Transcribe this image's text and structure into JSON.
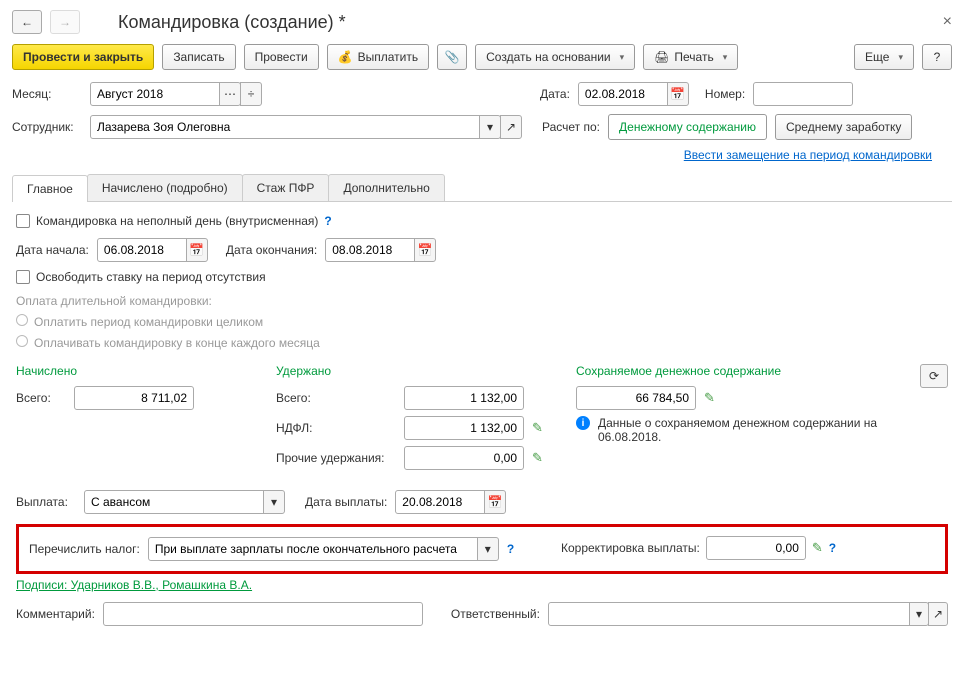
{
  "title": "Командировка (создание) *",
  "toolbar": {
    "post_close": "Провести и закрыть",
    "write": "Записать",
    "post": "Провести",
    "pay": "Выплатить",
    "create_based": "Создать на основании",
    "print": "Печать",
    "more": "Еще"
  },
  "fields": {
    "month_label": "Месяц:",
    "month_value": "Август 2018",
    "date_label": "Дата:",
    "date_value": "02.08.2018",
    "number_label": "Номер:",
    "number_value": "",
    "employee_label": "Сотрудник:",
    "employee_value": "Лазарева Зоя Олеговна",
    "calc_by_label": "Расчет по:",
    "calc_by_value": "Денежному содержанию",
    "avg_earn": "Среднему заработку",
    "substitution_link": "Ввести замещение на период командировки"
  },
  "tabs": {
    "main": "Главное",
    "accrued": "Начислено (подробно)",
    "pfr": "Стаж ПФР",
    "extra": "Дополнительно"
  },
  "main": {
    "partial_day": "Командировка на неполный день (внутрисменная)",
    "start_label": "Дата начала:",
    "start_value": "06.08.2018",
    "end_label": "Дата окончания:",
    "end_value": "08.08.2018",
    "release_rate": "Освободить ставку на период отсутствия",
    "long_trip_label": "Оплата длительной командировки:",
    "pay_whole": "Оплатить период командировки целиком",
    "pay_monthly": "Оплачивать командировку в конце каждого месяца"
  },
  "accrual": {
    "accrued_head": "Начислено",
    "withheld_head": "Удержано",
    "saved_head": "Сохраняемое денежное содержание",
    "total_label": "Всего:",
    "accrued_total": "8 711,02",
    "withheld_total": "1 132,00",
    "ndfl_label": "НДФЛ:",
    "ndfl_value": "1 132,00",
    "other_label": "Прочие удержания:",
    "other_value": "0,00",
    "saved_value": "66 784,50",
    "info_text": "Данные о сохраняемом денежном содержании на 06.08.2018."
  },
  "payment": {
    "pay_label": "Выплата:",
    "pay_value": "С авансом",
    "pay_date_label": "Дата выплаты:",
    "pay_date_value": "20.08.2018"
  },
  "tax": {
    "label": "Перечислить налог:",
    "value": "При выплате зарплаты после окончательного расчета",
    "correction_label": "Корректировка выплаты:",
    "correction_value": "0,00"
  },
  "signs": "Подписи: Ударников В.В., Ромашкина В.А.",
  "bottom": {
    "comment_label": "Комментарий:",
    "resp_label": "Ответственный:"
  }
}
